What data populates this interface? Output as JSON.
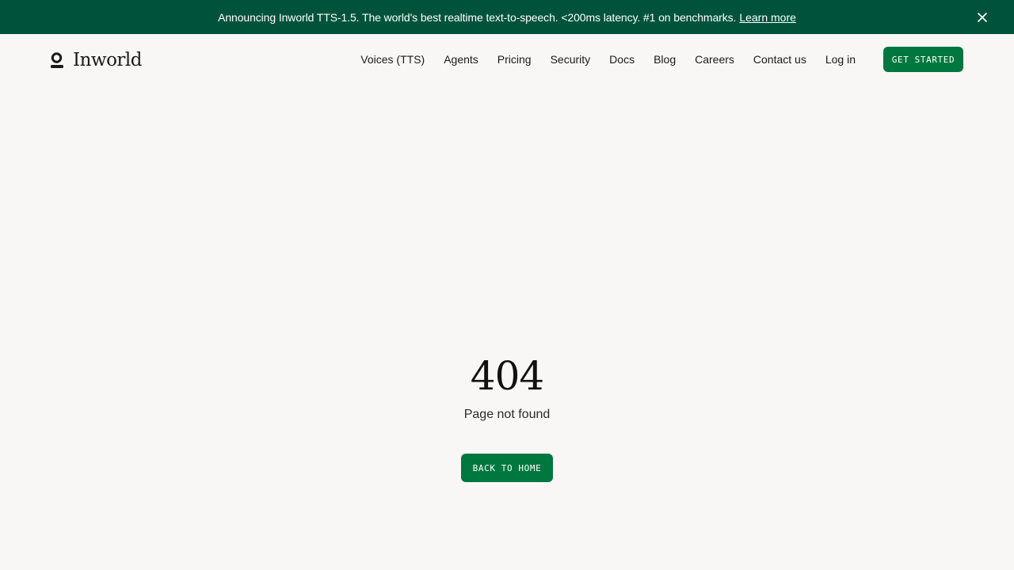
{
  "banner": {
    "text": "Announcing Inworld TTS-1.5. The world's best realtime text-to-speech. <200ms latency. #1 on benchmarks.",
    "link_label": "Learn more",
    "close_icon": "close-icon",
    "background": "#00533a"
  },
  "header": {
    "logo_text": "Inworld",
    "logo_icon": "inworld-logo-icon",
    "nav": [
      "Voices (TTS)",
      "Agents",
      "Pricing",
      "Security",
      "Docs",
      "Blog",
      "Careers",
      "Contact us",
      "Log in"
    ],
    "cta_label": "GET STARTED"
  },
  "main": {
    "code": "404",
    "message": "Page not found",
    "back_label": "BACK TO HOME"
  },
  "colors": {
    "accent": "#00773f",
    "page_background": "#f8f7f5"
  }
}
